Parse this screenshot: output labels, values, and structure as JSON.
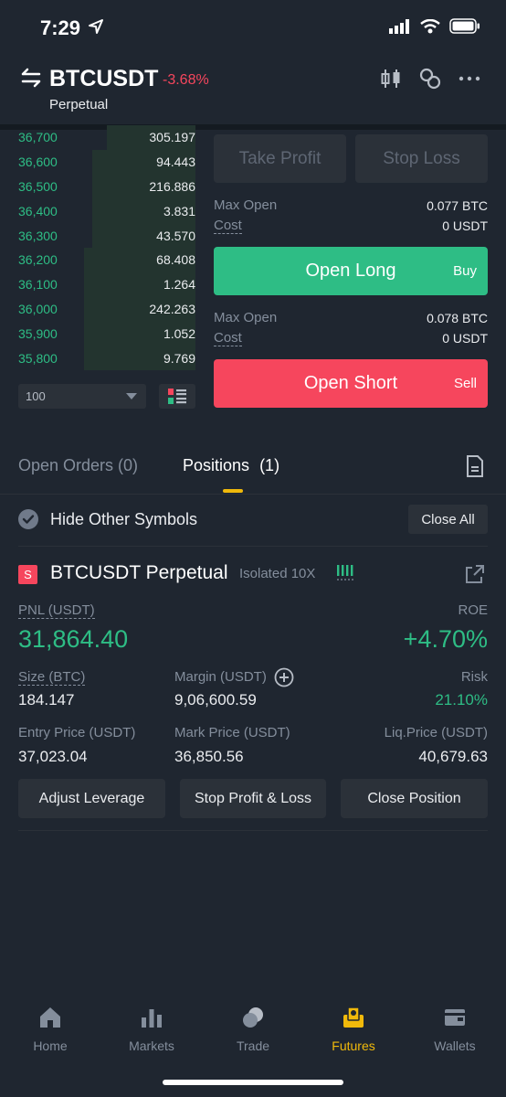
{
  "status": {
    "time": "7:29"
  },
  "header": {
    "symbol": "BTCUSDT",
    "change": "-3.68%",
    "subtitle": "Perpetual"
  },
  "orderbook": {
    "rows": [
      {
        "price": "36,700",
        "qty": "305.197",
        "depth": 0.5
      },
      {
        "price": "36,600",
        "qty": "94.443",
        "depth": 0.58
      },
      {
        "price": "36,500",
        "qty": "216.886",
        "depth": 0.58
      },
      {
        "price": "36,400",
        "qty": "3.831",
        "depth": 0.58
      },
      {
        "price": "36,300",
        "qty": "43.570",
        "depth": 0.58
      },
      {
        "price": "36,200",
        "qty": "68.408",
        "depth": 0.63
      },
      {
        "price": "36,100",
        "qty": "1.264",
        "depth": 0.63
      },
      {
        "price": "36,000",
        "qty": "242.263",
        "depth": 0.63
      },
      {
        "price": "35,900",
        "qty": "1.052",
        "depth": 0.63
      },
      {
        "price": "35,800",
        "qty": "9.769",
        "depth": 0.63
      }
    ],
    "depth_value": "100"
  },
  "trade_panel": {
    "take_profit": "Take Profit",
    "stop_loss": "Stop Loss",
    "long": {
      "max_open_label": "Max Open",
      "max_open_value": "0.077 BTC",
      "cost_label": "Cost",
      "cost_value": "0 USDT",
      "button": "Open Long",
      "side": "Buy"
    },
    "short": {
      "max_open_label": "Max Open",
      "max_open_value": "0.078 BTC",
      "cost_label": "Cost",
      "cost_value": "0 USDT",
      "button": "Open Short",
      "side": "Sell"
    }
  },
  "tabs": {
    "open_orders": "Open Orders (0)",
    "positions": "Positions",
    "positions_count": "(1)"
  },
  "filter": {
    "hide_label": "Hide Other Symbols",
    "close_all": "Close All"
  },
  "position": {
    "badge": "S",
    "title": "BTCUSDT Perpetual",
    "tag": "Isolated 10X",
    "pnl_label": "PNL (USDT)",
    "pnl_value": "31,864.40",
    "roe_label": "ROE",
    "roe_value": "+4.70%",
    "size_label": "Size (BTC)",
    "size_value": "184.147",
    "margin_label": "Margin (USDT)",
    "margin_value": "9,06,600.59",
    "risk_label": "Risk",
    "risk_value": "21.10%",
    "entry_label": "Entry Price (USDT)",
    "entry_value": "37,023.04",
    "mark_label": "Mark Price (USDT)",
    "mark_value": "36,850.56",
    "liq_label": "Liq.Price (USDT)",
    "liq_value": "40,679.63",
    "adjust_leverage": "Adjust Leverage",
    "stop_profit_loss": "Stop Profit & Loss",
    "close_position": "Close Position"
  },
  "nav": {
    "home": "Home",
    "markets": "Markets",
    "trade": "Trade",
    "futures": "Futures",
    "wallets": "Wallets"
  },
  "colors": {
    "green": "#2ebd85",
    "red": "#f6465d",
    "accent": "#f0b90b",
    "bg": "#1f2630"
  }
}
